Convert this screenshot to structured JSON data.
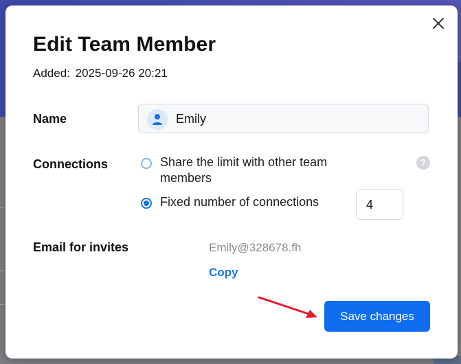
{
  "dialog": {
    "title": "Edit Team Member",
    "added_label": "Added:",
    "added_value": "2025-09-26 20:21",
    "close_icon": "close-icon"
  },
  "name": {
    "label": "Name",
    "value": "Emily",
    "avatar_icon": "user-icon"
  },
  "connections": {
    "label": "Connections",
    "options": [
      {
        "label_line1": "Share the limit with other team",
        "label_line2": "members",
        "selected": false
      },
      {
        "label": "Fixed number of connections",
        "selected": true
      }
    ],
    "fixed_value": "4",
    "help_icon": "?"
  },
  "email": {
    "label": "Email for invites",
    "value": "Emily@328678.fh",
    "copy_label": "Copy"
  },
  "actions": {
    "save_label": "Save changes"
  },
  "colors": {
    "accent": "#0f6ef0",
    "link": "#1a73e8",
    "annotation_arrow": "#e8192c"
  }
}
